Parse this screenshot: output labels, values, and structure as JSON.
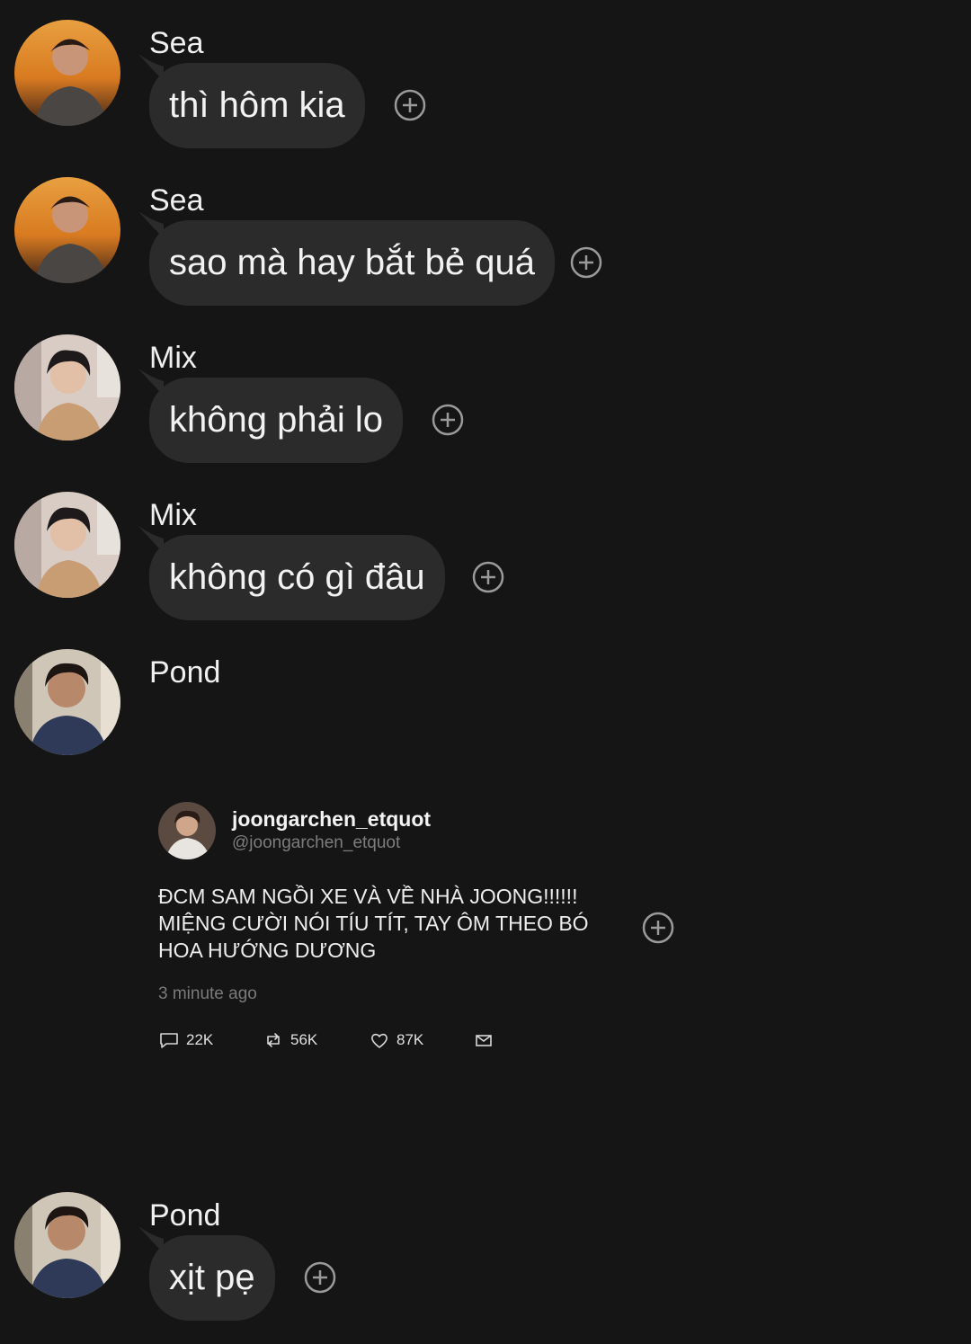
{
  "messages": [
    {
      "sender": "Sea",
      "text": "thì hôm kia",
      "avatar": "sea-avatar"
    },
    {
      "sender": "Sea",
      "text": "sao mà hay bắt bẻ quá",
      "avatar": "sea-avatar"
    },
    {
      "sender": "Mix",
      "text": "không phải lo",
      "avatar": "mix-avatar"
    },
    {
      "sender": "Mix",
      "text": "không có gì đâu",
      "avatar": "mix-avatar"
    },
    {
      "sender": "Pond",
      "avatar": "pond-avatar"
    },
    {
      "sender": "Pond",
      "text": "xịt pẹ",
      "avatar": "pond-avatar"
    }
  ],
  "tweet": {
    "name": "joongarchen_etquot",
    "handle": "@joongarchen_etquot",
    "text_lines": [
      "ĐCM SAM NGỒI XE VÀ VỀ NHÀ JOONG!!!!!!",
      "MIỆNG CƯỜI NÓI TÍU TÍT, TAY ÔM THEO BÓ",
      "HOA HƯỚNG DƯƠNG"
    ],
    "time": "3 minute ago",
    "replies": "22K",
    "retweets": "56K",
    "likes": "87K"
  },
  "icons": {
    "add": "plus-circle-icon",
    "reply": "speech-bubble-icon",
    "retweet": "retweet-icon",
    "like": "heart-icon",
    "message": "envelope-icon"
  },
  "colors": {
    "background": "#151515",
    "bubble": "#2b2b2b",
    "muted_text": "#7d7d7d"
  }
}
